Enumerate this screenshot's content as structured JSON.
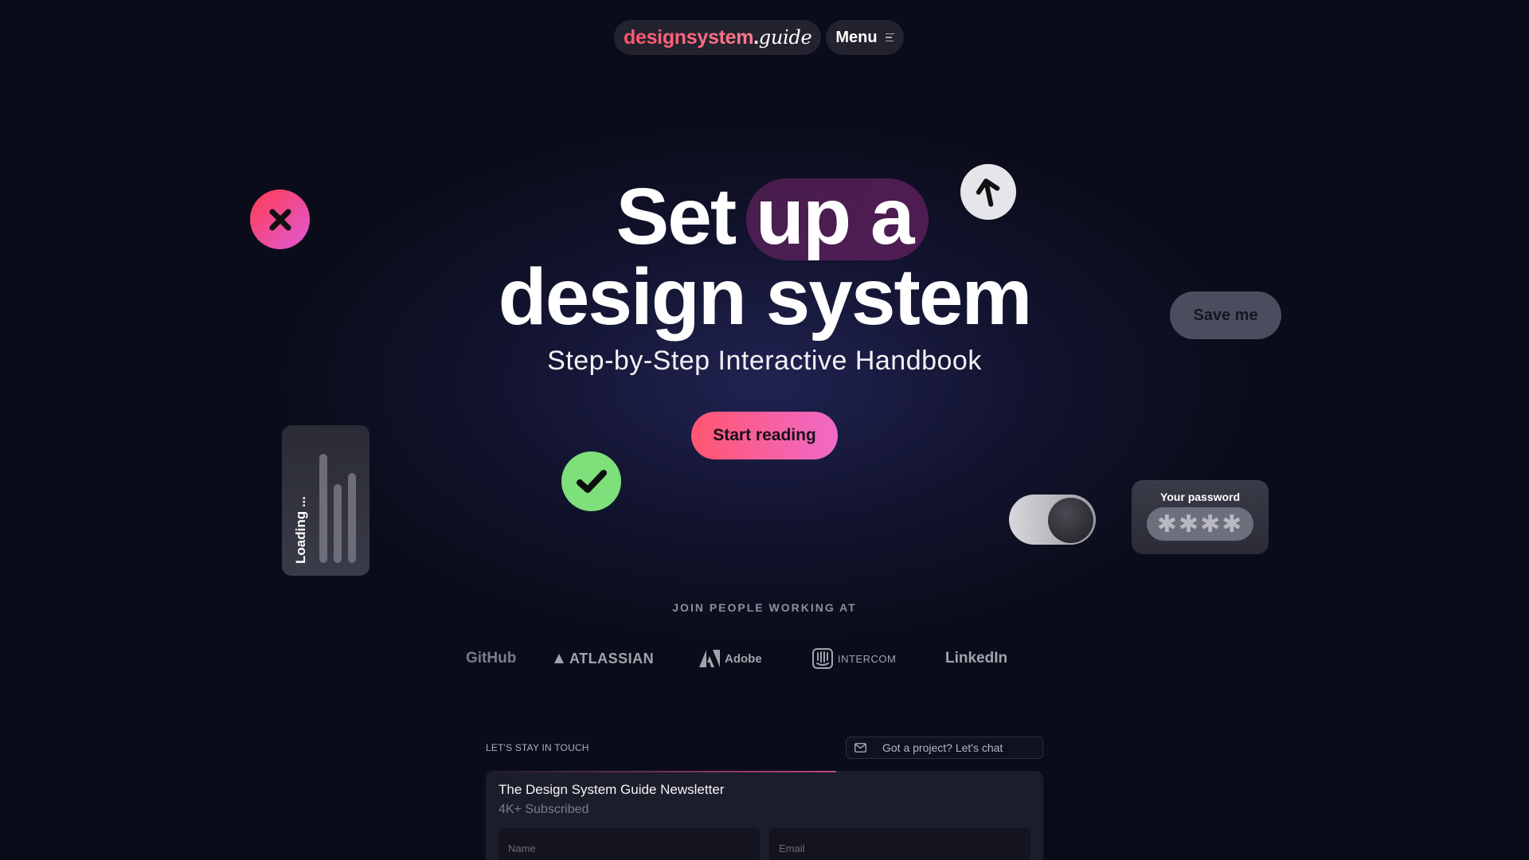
{
  "nav": {
    "brand": "designsystem",
    "dot": ".",
    "tld": "guide",
    "menu_label": "Menu"
  },
  "hero": {
    "title_line1": "Set up a",
    "title_line2": "design system",
    "subtitle": "Step-by-Step Interactive Handbook",
    "cta_label": "Start reading"
  },
  "widgets": {
    "save_button_label": "Save me",
    "loading_label": "Loading ...",
    "password_label": "Your password",
    "password_mask": "✱✱✱✱",
    "toggle_state": "on"
  },
  "companies": {
    "heading": "JOIN PEOPLE WORKING AT",
    "items": [
      "GitHub",
      "ATLASSIAN",
      "Adobe",
      "INTERCOM",
      "LinkedIn"
    ]
  },
  "newsletter": {
    "section_label": "LET'S STAY IN TOUCH",
    "chat_label": "Got a project? Let's chat",
    "title": "The Design System Guide Newsletter",
    "subscribed": "4K+ Subscribed",
    "name_placeholder": "Name",
    "email_placeholder": "Email"
  },
  "colors": {
    "background": "#0b0c1a",
    "accent_pink": "#ff5670",
    "accent_magenta": "#ef6ac8",
    "success_green": "#7ee07a"
  }
}
